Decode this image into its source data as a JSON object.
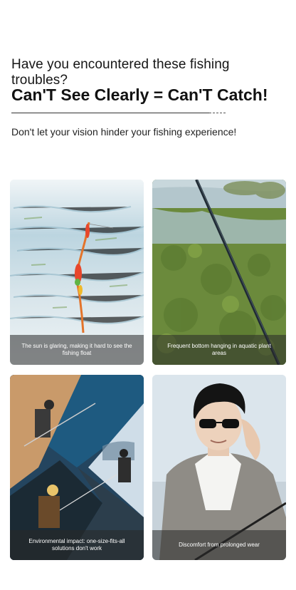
{
  "header": {
    "question": "Have you encountered these fishing troubles?",
    "headline": "Can'T See Clearly = Can'T Catch!",
    "subtext": "Don't let your vision hinder your fishing experience!"
  },
  "cards": [
    {
      "caption": "The sun is glaring, making it hard to see the fishing float"
    },
    {
      "caption": "Frequent bottom hanging in aquatic plant areas"
    },
    {
      "caption": "Environmental impact: one-size-fits-all solutions don't work"
    },
    {
      "caption": "Discomfort from prolonged wear"
    }
  ]
}
